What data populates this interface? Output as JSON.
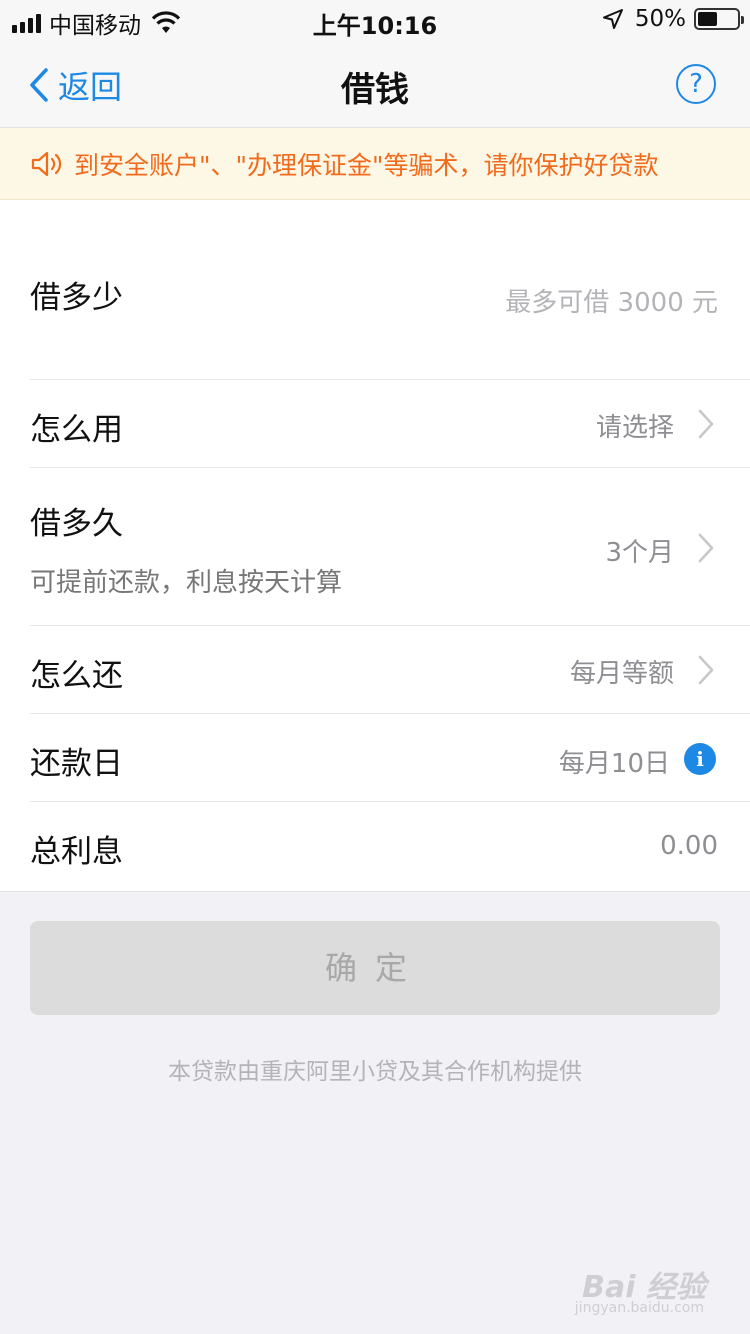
{
  "status_bar": {
    "carrier": "中国移动",
    "time": "上午10:16",
    "battery_percent": "50%",
    "battery_level": 0.5
  },
  "nav": {
    "back_label": "返回",
    "title": "借钱",
    "help_label": "?"
  },
  "notice": {
    "text": "到安全账户\"、\"办理保证金\"等骗术，请你保护好贷款"
  },
  "form": {
    "amount": {
      "label": "借多少",
      "placeholder": "最多可借 3000 元"
    },
    "usage": {
      "label": "怎么用",
      "value": "请选择"
    },
    "term": {
      "label": "借多久",
      "sub": "可提前还款，利息按天计算",
      "value": "3个月"
    },
    "repay_method": {
      "label": "怎么还",
      "value": "每月等额"
    },
    "repay_day": {
      "label": "还款日",
      "value": "每月10日",
      "info_label": "i"
    },
    "interest": {
      "label": "总利息",
      "value": "0.00"
    }
  },
  "confirm_label": "确定",
  "footer_note": "本贷款由重庆阿里小贷及其合作机构提供",
  "watermark": {
    "text": "Bai 经验",
    "sub": "jingyan.baidu.com"
  },
  "colors": {
    "accent": "#1e88e5",
    "notice_text": "#f26b1d",
    "notice_bg": "#fdf7e6"
  }
}
